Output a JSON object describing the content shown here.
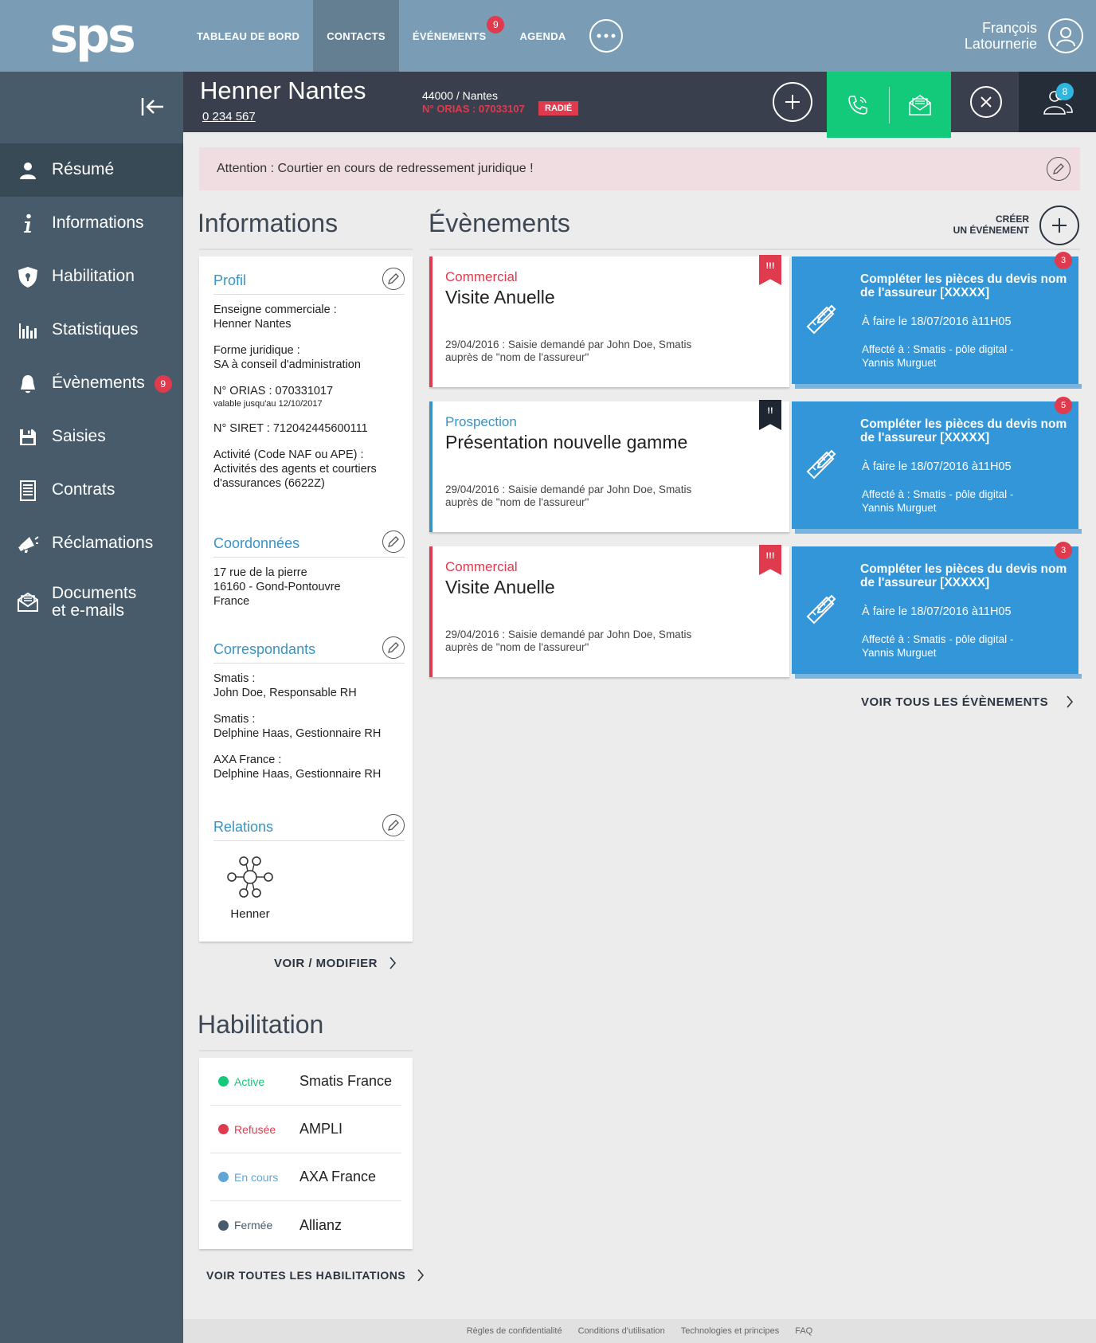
{
  "app": {
    "logo": "sps"
  },
  "topbar": {
    "tabs": [
      {
        "label": "TABLEAU DE BORD"
      },
      {
        "label": "CONTACTS"
      },
      {
        "label": "ÉVÉNEMENTS",
        "badge": "9"
      },
      {
        "label": "AGENDA"
      }
    ],
    "user_first": "François",
    "user_last": "Latournerie"
  },
  "sidebar": {
    "items": [
      {
        "label": "Résumé",
        "icon": "user-icon"
      },
      {
        "label": "Informations",
        "icon": "info-icon"
      },
      {
        "label": "Habilitation",
        "icon": "shield-icon"
      },
      {
        "label": "Statistiques",
        "icon": "bar-chart-icon"
      },
      {
        "label": "Évènements",
        "icon": "bell-icon",
        "badge": "9"
      },
      {
        "label": "Saisies",
        "icon": "floppy-icon"
      },
      {
        "label": "Contrats",
        "icon": "document-icon"
      },
      {
        "label": "Réclamations",
        "icon": "megaphone-icon"
      },
      {
        "label_line1": "Documents",
        "label_line2": "et e-mails",
        "icon": "mail-icon"
      }
    ]
  },
  "contact": {
    "name": "Henner Nantes",
    "number": "0 234 567",
    "city": "44000 / Nantes",
    "orias": "N° ORIAS : 07033107",
    "status_badge": "RADIÉ",
    "users_badge": "8"
  },
  "alert": {
    "text": "Attention : Courtier en cours de redressement juridique !"
  },
  "informations": {
    "title": "Informations",
    "profil": {
      "title": "Profil",
      "enseigne_label": "Enseigne commerciale :",
      "enseigne_value": "Henner Nantes",
      "forme_label": "Forme juridique :",
      "forme_value": "SA à conseil d'administration",
      "orias": "N° ORIAS : 070331017",
      "orias_valid": "valable jusqu'au 12/10/2017",
      "siret": "N° SIRET : 712042445600111",
      "activite_label": "Activité (Code NAF ou APE) :",
      "activite_line1": "Activités des agents et courtiers",
      "activite_line2": "d'assurances (6622Z)"
    },
    "coordonnees": {
      "title": "Coordonnées",
      "line1": "17 rue de la pierre",
      "line2": "16160 - Gond-Pontouvre",
      "line3": "France"
    },
    "correspondants": {
      "title": "Correspondants",
      "items": [
        {
          "org": "Smatis :",
          "person": "John Doe, Responsable RH"
        },
        {
          "org": "Smatis :",
          "person": "Delphine Haas, Gestionnaire RH"
        },
        {
          "org": "AXA France :",
          "person": "Delphine Haas, Gestionnaire RH"
        }
      ]
    },
    "relations": {
      "title": "Relations",
      "node": "Henner"
    },
    "link": "VOIR / MODIFIER"
  },
  "habilitation": {
    "title": "Habilitation",
    "rows": [
      {
        "status": "Active",
        "name": "Smatis France",
        "color": "#13c97a"
      },
      {
        "status": "Refusée",
        "name": "AMPLI",
        "color": "#e03a4e"
      },
      {
        "status": "En cours",
        "name": "AXA France",
        "color": "#5fa6d6"
      },
      {
        "status": "Fermée",
        "name": "Allianz",
        "color": "#475b6b"
      }
    ],
    "link": "VOIR TOUTES LES HABILITATIONS"
  },
  "evenements": {
    "title": "Évènements",
    "create_line1": "CRÉER",
    "create_line2": "UN ÉVÉNEMENT",
    "cards": [
      {
        "type": "Commercial",
        "title": "Visite Anuelle",
        "desc_line1": "29/04/2016 : Saisie demandé par John Doe, Smatis",
        "desc_line2": "auprès de \"nom de l'assureur\"",
        "ribbon": "!!!",
        "color": "#e03a4e"
      },
      {
        "type": "Prospection",
        "title": "Présentation nouvelle gamme",
        "desc_line1": "29/04/2016 : Saisie demandé par John Doe, Smatis",
        "desc_line2": "auprès de \"nom de l'assureur\"",
        "ribbon": "!!",
        "color": "#3a93c3"
      },
      {
        "type": "Commercial",
        "title": "Visite Anuelle",
        "desc_line1": "29/04/2016 : Saisie demandé par John Doe, Smatis",
        "desc_line2": "auprès de \"nom de l'assureur\"",
        "ribbon": "!!!",
        "color": "#e03a4e"
      }
    ],
    "tasks": [
      {
        "title": "Compléter les pièces du devis nom de l'assureur [XXXXX]",
        "date": "À faire le 18/07/2016 à11H05",
        "assign_line1": "Affecté à : Smatis - pôle digital -",
        "assign_line2": "Yannis Murguet",
        "badge": "3"
      },
      {
        "title": "Compléter les pièces du devis nom de l'assureur [XXXXX]",
        "date": "À faire le 18/07/2016 à11H05",
        "assign_line1": "Affecté à : Smatis - pôle digital -",
        "assign_line2": "Yannis Murguet",
        "badge": "5"
      },
      {
        "title": "Compléter les pièces du devis nom de l'assureur [XXXXX]",
        "date": "À faire le 18/07/2016 à11H05",
        "assign_line1": "Affecté à : Smatis - pôle digital -",
        "assign_line2": "Yannis Murguet",
        "badge": "3"
      }
    ],
    "link": "VOIR TOUS LES ÉVÈNEMENTS"
  },
  "footer": {
    "links": [
      "Règles de confidentialité",
      "Conditions d'utilisation",
      "Technologies et principes",
      "FAQ"
    ]
  }
}
